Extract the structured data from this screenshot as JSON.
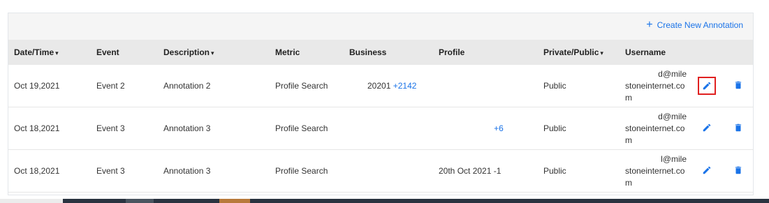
{
  "toolbar": {
    "create_label": "Create New Annotation",
    "plus": "+"
  },
  "columns": {
    "datetime": "Date/Time",
    "event": "Event",
    "description": "Description",
    "metric": "Metric",
    "business": "Business",
    "profile": "Profile",
    "privacy": "Private/Public",
    "username": "Username",
    "sort_caret": "▾"
  },
  "rows": [
    {
      "datetime": "Oct 19,2021",
      "event": "Event 2",
      "description": "Annotation 2",
      "metric": "Profile Search",
      "business": "20201",
      "business_extra": "+2142",
      "profile": "",
      "privacy": "Public",
      "user_line1": "d@mile",
      "user_line2": "stoneinternet.co",
      "user_line3": "m"
    },
    {
      "datetime": "Oct 18,2021",
      "event": "Event 3",
      "description": "Annotation 3",
      "metric": "Profile Search",
      "business": "",
      "business_extra": "",
      "profile": "+6",
      "privacy": "Public",
      "user_line1": "d@mile",
      "user_line2": "stoneinternet.co",
      "user_line3": "m"
    },
    {
      "datetime": "Oct 18,2021",
      "event": "Event 3",
      "description": "Annotation 3",
      "metric": "Profile Search",
      "business": "",
      "business_extra": "",
      "profile": "20th Oct 2021 -1",
      "privacy": "Public",
      "user_line1": "l@mile",
      "user_line2": "stoneinternet.co",
      "user_line3": "m"
    }
  ],
  "icons": {
    "edit": "pencil-icon",
    "delete": "trash-icon",
    "accent": "#1a73e8",
    "highlight": "#e02020"
  }
}
